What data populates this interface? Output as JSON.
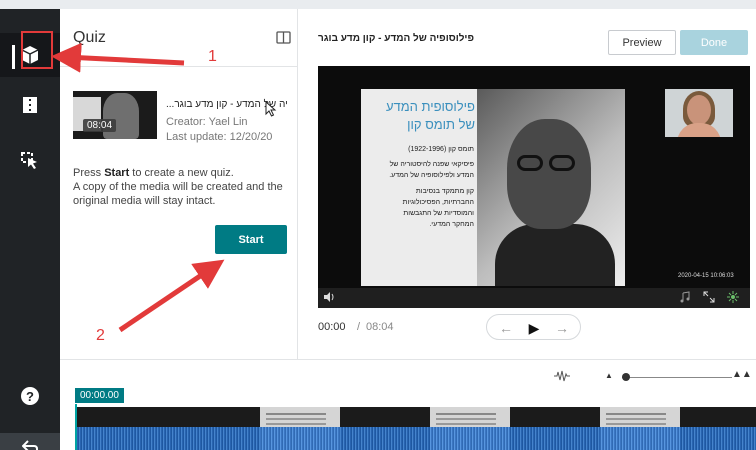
{
  "rail": {
    "items": [
      {
        "icon": "cube-icon",
        "active": true
      },
      {
        "icon": "hotspots-icon",
        "active": false
      },
      {
        "icon": "cursor-select-icon",
        "active": false
      }
    ],
    "help_icon": "help-icon",
    "help_glyph": "?",
    "back_icon": "back-arrow-icon"
  },
  "quiz": {
    "title": "Quiz",
    "media": {
      "title": "...יה של המדע - קון מדע בוגר",
      "duration": "08:04",
      "creator": "Creator: Yael Lin",
      "last_update": "Last update: 12/20/20"
    },
    "desc_line1_pre": "Press ",
    "desc_line1_bold": "Start",
    "desc_line1_post": " to create a new quiz.",
    "desc_line2": "A copy of the media will be created and the",
    "desc_line3": "original media will stay intact.",
    "start_label": "Start"
  },
  "editor": {
    "video_title": "פילוסופיה של המדע - קון מדע בוגר",
    "preview_label": "Preview",
    "done_label": "Done",
    "slide": {
      "heading1": "פילוסופית המדע",
      "heading2": "של תומס קון",
      "lines": [
        "תומס קון (1922-1996)",
        "פיסיקאי שפנה להיסטוריה של",
        "המדע ולפילוסופיה של המדע.",
        "קון מתמקד בנסיבות",
        "החברתיות, הפסיכולוגיות",
        "והמוסדיות של התגבשות",
        "המחקר המדעי."
      ]
    },
    "video_timestamp": "2020-04-15 10:06:03",
    "time_current": "00:00",
    "time_separator": "/",
    "time_total": "08:04",
    "nav": {
      "prev": "←",
      "play": "▶",
      "next": "→"
    }
  },
  "timeline": {
    "time_label": "00:00.00",
    "zoom_out": "▲",
    "zoom_in": "▲▲",
    "zoom_level": 0.05
  },
  "annotations": {
    "callout_1": "1",
    "callout_2": "2",
    "color": "#e23a3a"
  },
  "colors": {
    "accent": "#007b84",
    "rail_bg": "#202326",
    "done_disabled": "#a9d3de",
    "slide_heading": "#3a8fbd"
  }
}
